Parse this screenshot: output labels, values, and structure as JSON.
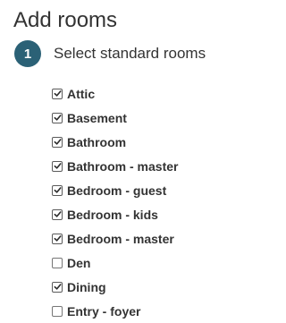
{
  "header": {
    "title": "Add rooms"
  },
  "step": {
    "number": "1",
    "title": "Select standard rooms"
  },
  "rooms": [
    {
      "label": "Attic",
      "checked": true
    },
    {
      "label": "Basement",
      "checked": true
    },
    {
      "label": "Bathroom",
      "checked": true
    },
    {
      "label": "Bathroom - master",
      "checked": true
    },
    {
      "label": "Bedroom - guest",
      "checked": true
    },
    {
      "label": "Bedroom - kids",
      "checked": true
    },
    {
      "label": "Bedroom - master",
      "checked": true
    },
    {
      "label": "Den",
      "checked": false
    },
    {
      "label": "Dining",
      "checked": true
    },
    {
      "label": "Entry - foyer",
      "checked": false
    }
  ],
  "colors": {
    "badge": "#2b6176",
    "text": "#333333"
  }
}
